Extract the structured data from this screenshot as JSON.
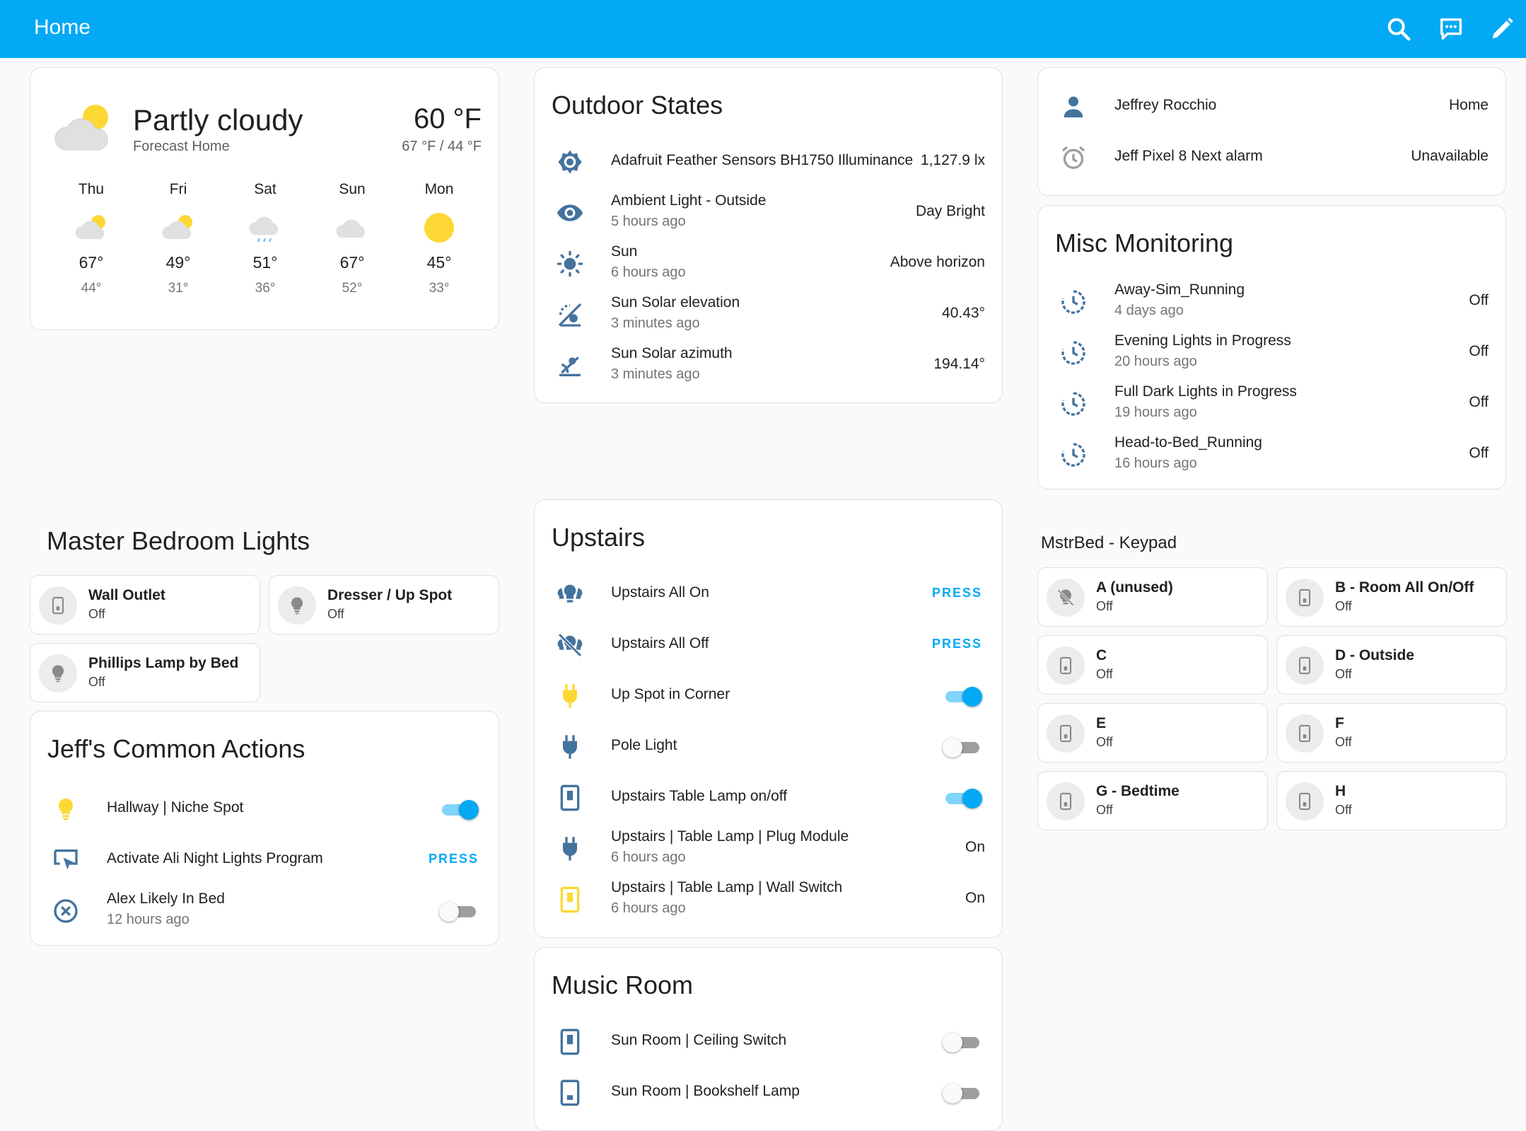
{
  "header": {
    "title": "Home"
  },
  "colors": {
    "accent": "#03a9f4",
    "icon": "#44739e",
    "active": "#fdd835"
  },
  "weather": {
    "condition": "Partly cloudy",
    "location": "Forecast Home",
    "temp": "60 °F",
    "hilo": "67 °F / 44 °F",
    "forecast": [
      {
        "day": "Thu",
        "icon": "partly-cloudy-icon",
        "hi": "67°",
        "lo": "44°"
      },
      {
        "day": "Fri",
        "icon": "partly-cloudy-icon",
        "hi": "49°",
        "lo": "31°"
      },
      {
        "day": "Sat",
        "icon": "rainy-icon",
        "hi": "51°",
        "lo": "36°"
      },
      {
        "day": "Sun",
        "icon": "cloudy-icon",
        "hi": "67°",
        "lo": "52°"
      },
      {
        "day": "Mon",
        "icon": "sunny-icon",
        "hi": "45°",
        "lo": "33°"
      }
    ]
  },
  "outdoor": {
    "title": "Outdoor States",
    "rows": [
      {
        "name": "Adafruit Feather Sensors BH1750 Illuminance",
        "value": "1,127.9 lx"
      },
      {
        "name": "Ambient Light - Outside",
        "sub": "5 hours ago",
        "value": "Day Bright"
      },
      {
        "name": "Sun",
        "sub": "6 hours ago",
        "value": "Above horizon"
      },
      {
        "name": "Sun Solar elevation",
        "sub": "3 minutes ago",
        "value": "40.43°"
      },
      {
        "name": "Sun Solar azimuth",
        "sub": "3 minutes ago",
        "value": "194.14°"
      }
    ]
  },
  "people": {
    "rows": [
      {
        "name": "Jeffrey Rocchio",
        "value": "Home"
      },
      {
        "name": "Jeff Pixel 8 Next alarm",
        "value": "Unavailable"
      }
    ]
  },
  "misc": {
    "title": "Misc Monitoring",
    "rows": [
      {
        "name": "Away-Sim_Running",
        "sub": "4 days ago",
        "value": "Off"
      },
      {
        "name": "Evening Lights in Progress",
        "sub": "20 hours ago",
        "value": "Off"
      },
      {
        "name": "Full Dark Lights in Progress",
        "sub": "19 hours ago",
        "value": "Off"
      },
      {
        "name": "Head-to-Bed_Running",
        "sub": "16 hours ago",
        "value": "Off"
      }
    ]
  },
  "master": {
    "title": "Master Bedroom Lights",
    "tiles": [
      {
        "name": "Wall Outlet",
        "state": "Off"
      },
      {
        "name": "Dresser / Up Spot",
        "state": "Off"
      },
      {
        "name": "Phillips Lamp by Bed",
        "state": "Off"
      }
    ]
  },
  "actions": {
    "title": "Jeff's Common Actions",
    "rows": [
      {
        "name": "Hallway | Niche Spot"
      },
      {
        "name": "Activate Ali Night Lights Program",
        "action": "PRESS"
      },
      {
        "name": "Alex Likely In Bed",
        "sub": "12 hours ago"
      }
    ]
  },
  "upstairs": {
    "title": "Upstairs",
    "rows": [
      {
        "name": "Upstairs All On",
        "action": "PRESS"
      },
      {
        "name": "Upstairs All Off",
        "action": "PRESS"
      },
      {
        "name": "Up Spot in Corner"
      },
      {
        "name": "Pole Light"
      },
      {
        "name": "Upstairs Table Lamp on/off"
      },
      {
        "name": "Upstairs | Table Lamp | Plug Module",
        "sub": "6 hours ago",
        "value": "On"
      },
      {
        "name": "Upstairs | Table Lamp | Wall Switch",
        "sub": "6 hours ago",
        "value": "On"
      }
    ]
  },
  "music": {
    "title": "Music Room",
    "rows": [
      {
        "name": "Sun Room | Ceiling Switch"
      },
      {
        "name": "Sun Room | Bookshelf Lamp"
      }
    ]
  },
  "keypad": {
    "title": "MstrBed - Keypad",
    "tiles": [
      {
        "name": "A (unused)",
        "state": "Off"
      },
      {
        "name": "B - Room All On/Off",
        "state": "Off"
      },
      {
        "name": "C",
        "state": "Off"
      },
      {
        "name": "D - Outside",
        "state": "Off"
      },
      {
        "name": "E",
        "state": "Off"
      },
      {
        "name": "F",
        "state": "Off"
      },
      {
        "name": "G - Bedtime",
        "state": "Off"
      },
      {
        "name": "H",
        "state": "Off"
      }
    ]
  }
}
